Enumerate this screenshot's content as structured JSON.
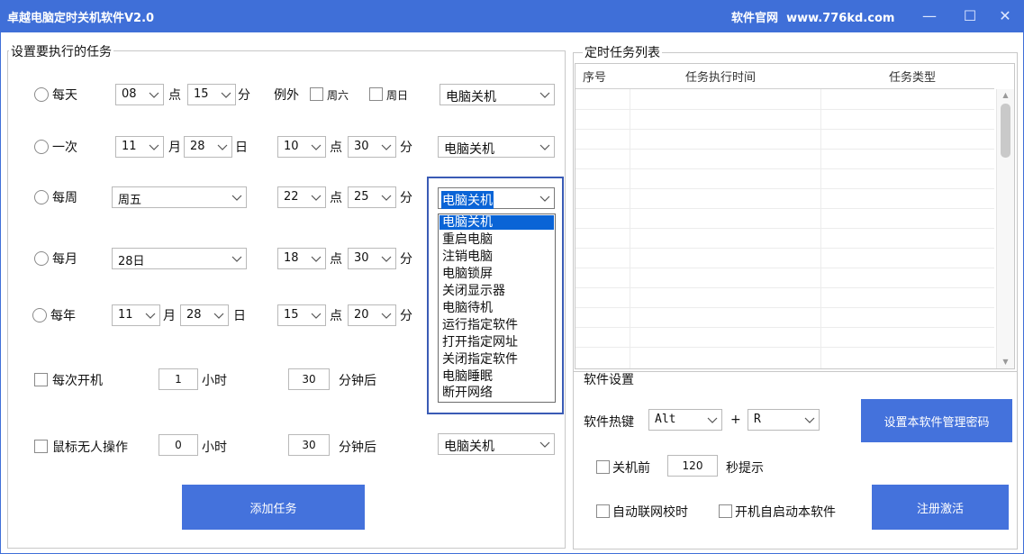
{
  "window": {
    "title": "卓越电脑定时关机软件V2.0",
    "site_label": "软件官网",
    "site_url": "www.776kd.com",
    "minimize": "—",
    "maximize": "☐",
    "close": "✕"
  },
  "tasks_group": {
    "title": "设置要执行的任务",
    "daily": {
      "label": "每天",
      "hour": "08",
      "hour_unit": "点",
      "minute": "15",
      "minute_unit": "分",
      "except_label": "例外",
      "sat_label": "周六",
      "sun_label": "周日",
      "action": "电脑关机"
    },
    "once": {
      "label": "一次",
      "month": "11",
      "month_unit": "月",
      "day": "28",
      "day_unit": "日",
      "hour": "10",
      "hour_unit": "点",
      "minute": "30",
      "minute_unit": "分",
      "action": "电脑关机"
    },
    "weekly": {
      "label": "每周",
      "weekday": "周五",
      "hour": "22",
      "hour_unit": "点",
      "minute": "25",
      "minute_unit": "分",
      "action": "电脑关机"
    },
    "monthly": {
      "label": "每月",
      "day": "28日",
      "hour": "18",
      "hour_unit": "点",
      "minute": "30",
      "minute_unit": "分"
    },
    "yearly": {
      "label": "每年",
      "month": "11",
      "month_unit": "月",
      "day": "28",
      "day_unit": "日",
      "hour": "15",
      "hour_unit": "点",
      "minute": "20",
      "minute_unit": "分"
    },
    "each_boot": {
      "label": "每次开机",
      "hours": "1",
      "hours_unit": "小时",
      "minutes": "30",
      "minutes_unit": "分钟后"
    },
    "idle": {
      "label": "鼠标无人操作",
      "hours": "0",
      "hours_unit": "小时",
      "minutes": "30",
      "minutes_unit": "分钟后",
      "action": "电脑关机"
    },
    "add_button": "添加任务"
  },
  "action_dropdown": {
    "selected": "电脑关机",
    "options": [
      "电脑关机",
      "重启电脑",
      "注销电脑",
      "电脑锁屏",
      "关闭显示器",
      "电脑待机",
      "运行指定软件",
      "打开指定网址",
      "关闭指定软件",
      "电脑睡眠",
      "断开网络"
    ]
  },
  "task_list": {
    "title": "定时任务列表",
    "columns": [
      "序号",
      "任务执行时间",
      "任务类型"
    ]
  },
  "settings": {
    "title": "软件设置",
    "hotkey_label": "软件热键",
    "hotkey_mod": "Alt",
    "plus": "+",
    "hotkey_key": "R",
    "password_button": "设置本软件管理密码",
    "before_shutdown_label": "关机前",
    "before_shutdown_seconds": "120",
    "before_shutdown_unit": "秒提示",
    "auto_sync_label": "自动联网校时",
    "autostart_label": "开机自启动本软件",
    "register_button": "注册激活"
  }
}
